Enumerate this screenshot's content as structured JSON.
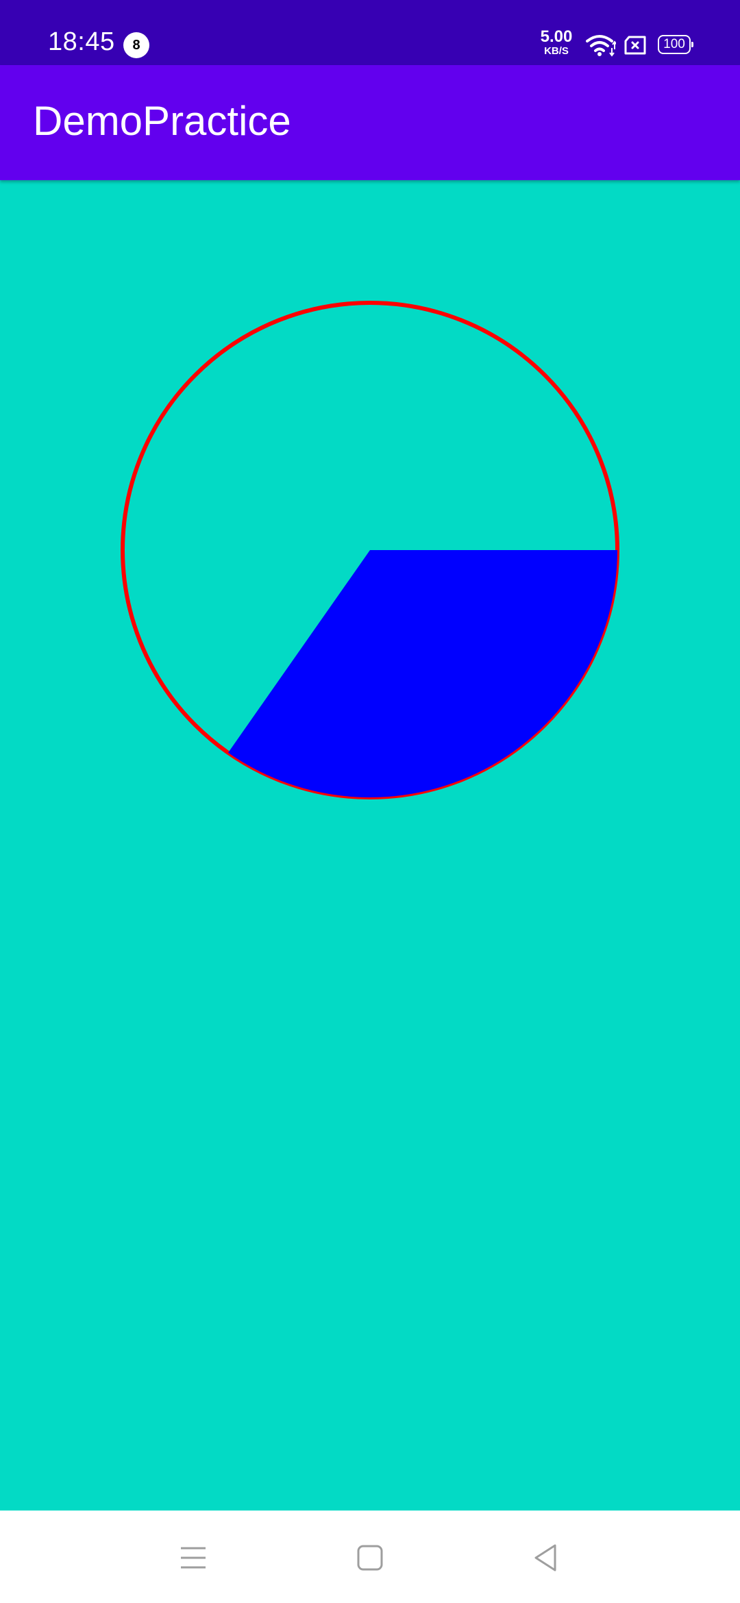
{
  "status_bar": {
    "time": "18:45",
    "notification_count": "8",
    "net_speed": "5.00",
    "net_speed_unit": "KB/S",
    "battery": "100",
    "icons": [
      "wifi-icon",
      "sim-blocked-icon",
      "battery-icon"
    ]
  },
  "app_bar": {
    "title": "DemoPractice"
  },
  "colors": {
    "status_bar": "#3700B3",
    "app_bar": "#6200EE",
    "background": "#03DAC5",
    "circle_stroke": "#FF0000",
    "sector_fill": "#0000FF",
    "nav_icons": "#9E9E9E"
  },
  "drawing": {
    "sector_start_deg": 0,
    "sector_sweep_deg": 125
  },
  "nav_bar": {
    "icons": [
      "recents-menu-icon",
      "home-square-icon",
      "back-triangle-icon"
    ]
  }
}
